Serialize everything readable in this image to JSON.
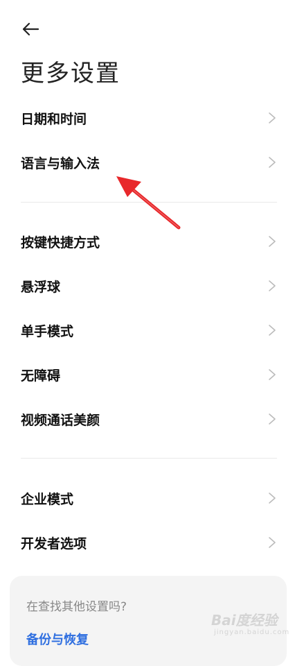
{
  "header": {
    "back_icon": "arrow-left-icon",
    "title": "更多设置"
  },
  "group1": [
    {
      "label": "日期和时间"
    },
    {
      "label": "语言与输入法"
    }
  ],
  "group2": [
    {
      "label": "按键快捷方式"
    },
    {
      "label": "悬浮球"
    },
    {
      "label": "单手模式"
    },
    {
      "label": "无障碍"
    },
    {
      "label": "视频通话美颜"
    }
  ],
  "group3": [
    {
      "label": "企业模式"
    },
    {
      "label": "开发者选项"
    }
  ],
  "search_card": {
    "question": "在查找其他设置吗?",
    "link": "备份与恢复"
  },
  "watermark": {
    "brand": "Bai度经验",
    "sub": "jingyan.baidu.com"
  },
  "colors": {
    "annotation_arrow": "#e8282b",
    "link": "#2f6fe0"
  }
}
